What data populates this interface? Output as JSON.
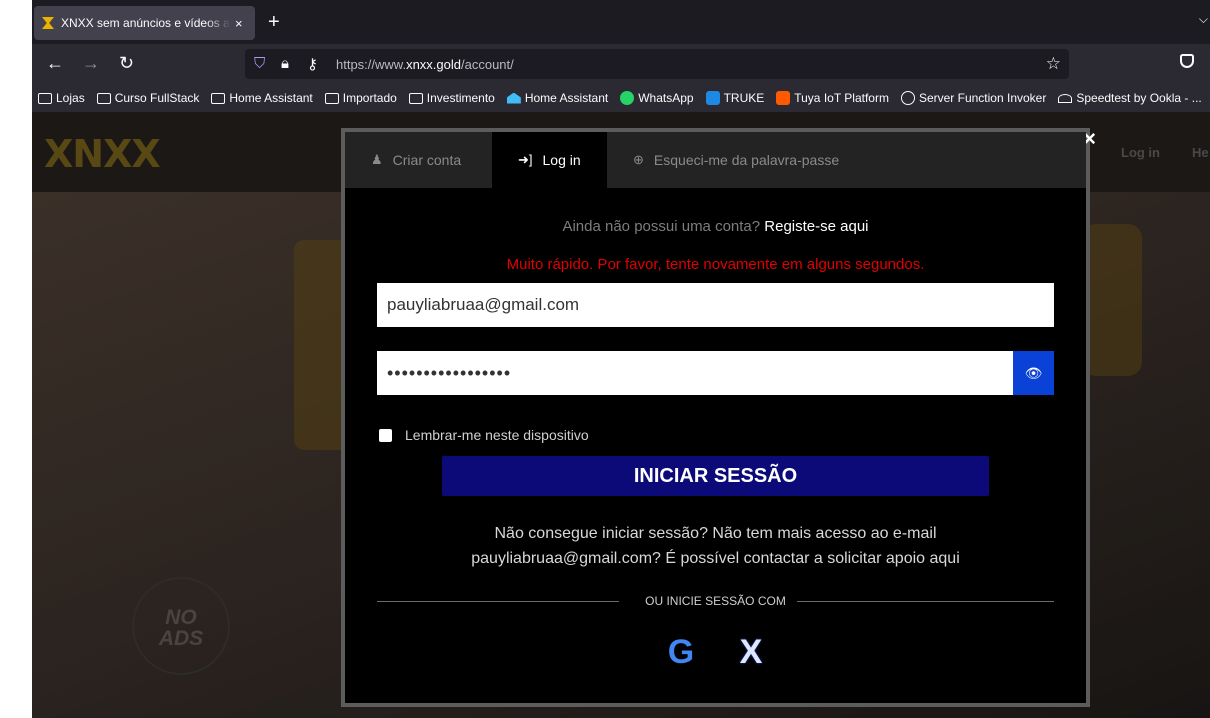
{
  "browser": {
    "tab_title": "XNXX sem anúncios e vídeos ad",
    "tab_close": "×",
    "new_tab": "+",
    "tab_list": "⌵",
    "url_prefix": "https://www.",
    "url_domain": "xnxx.gold",
    "url_path": "/account/",
    "bookmarks": [
      {
        "label": "Lojas",
        "icon": "folder-icon"
      },
      {
        "label": "Curso FullStack",
        "icon": "folder-icon"
      },
      {
        "label": "Home Assistant",
        "icon": "folder-icon"
      },
      {
        "label": "Importado",
        "icon": "folder-icon"
      },
      {
        "label": "Investimento",
        "icon": "folder-icon"
      },
      {
        "label": "Home Assistant",
        "icon": "home-assistant-icon"
      },
      {
        "label": "WhatsApp",
        "icon": "whatsapp-icon"
      },
      {
        "label": "TRUKE",
        "icon": "truke-icon"
      },
      {
        "label": "Tuya IoT Platform",
        "icon": "tuya-icon"
      },
      {
        "label": "Server Function Invoker",
        "icon": "globe-icon"
      },
      {
        "label": "Speedtest by Ookla - ...",
        "icon": "speedtest-icon"
      }
    ]
  },
  "site": {
    "logo": "XNXX",
    "nav_login": "Log in",
    "nav_help": "He",
    "no_ads_1": "NO",
    "no_ads_2": "ADS"
  },
  "modal": {
    "close": "×",
    "tabs": [
      {
        "label": "Criar conta",
        "icon": "♟",
        "active": false
      },
      {
        "label": "Log in",
        "icon": "➜]",
        "active": true
      },
      {
        "label": "Esqueci-me da palavra-passe",
        "icon": "⊕",
        "active": false
      }
    ],
    "prompt": "Ainda não possui uma conta?",
    "register_link": "Registe-se aqui",
    "error": "Muito rápido. Por favor, tente novamente em alguns segundos.",
    "email_value": "pauyliabruaa@gmail.com",
    "password_value": "•••••••••••••••••",
    "remember_label": "Lembrar-me neste dispositivo",
    "remember_checked": false,
    "submit_label": "INICIAR SESSÃO",
    "help_line1": "Não consegue iniciar sessão? Não tem mais acesso ao e-mail",
    "help_line2": "pauyliabruaa@gmail.com? É possível contactar a solicitar apoio aqui",
    "divider_label": "OU INICIE SESSÃO COM",
    "social_google": "G",
    "social_x": "X"
  },
  "colors": {
    "error": "#e10000",
    "submit_bg": "#0b0a78",
    "eye_button": "#0a41d6"
  }
}
